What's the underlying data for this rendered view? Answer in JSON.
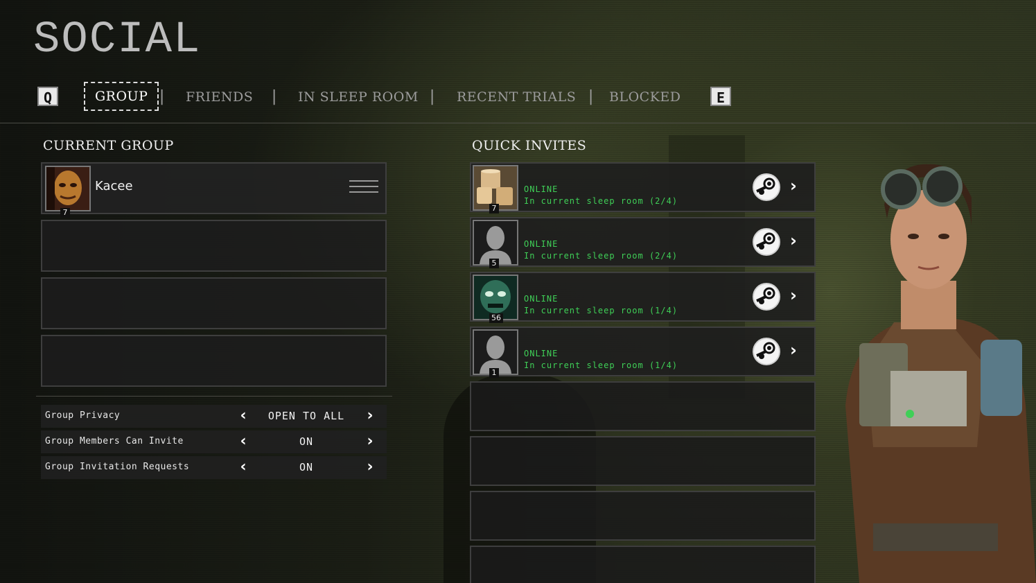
{
  "page": {
    "title": "SOCIAL"
  },
  "tabs": {
    "prev_key": "Q",
    "next_key": "E",
    "items": [
      "GROUP",
      "FRIENDS",
      "IN SLEEP ROOM",
      "RECENT TRIALS",
      "BLOCKED"
    ],
    "active": "GROUP",
    "separator": "|"
  },
  "current_group": {
    "title": "CURRENT GROUP",
    "members": [
      {
        "name": "Kacee",
        "level": "7"
      }
    ]
  },
  "settings": [
    {
      "label": "Group Privacy",
      "value": "OPEN TO ALL"
    },
    {
      "label": "Group Members Can Invite",
      "value": "ON"
    },
    {
      "label": "Group Invitation Requests",
      "value": "ON"
    }
  ],
  "quick_invites": {
    "title": "QUICK INVITES",
    "players": [
      {
        "level": "7",
        "status": "ONLINE",
        "room": "In current sleep room (2/4)",
        "avatar": "cups-avatar"
      },
      {
        "level": "5",
        "status": "ONLINE",
        "room": "In current sleep room (2/4)",
        "avatar": "default-silhouette-avatar"
      },
      {
        "level": "56",
        "status": "ONLINE",
        "room": "In current sleep room (1/4)",
        "avatar": "creature-avatar"
      },
      {
        "level": "1",
        "status": "ONLINE",
        "room": "In current sleep room (1/4)",
        "avatar": "default-silhouette-avatar"
      }
    ]
  },
  "colors": {
    "online": "#3fcf57",
    "panel": "#1e1e1e",
    "accent_bg": "#343a22"
  },
  "icons": {
    "steam": "steam-icon",
    "chevron_left": "chevron-left-icon",
    "chevron_right": "chevron-right-icon",
    "menu": "hamburger-menu-icon"
  }
}
